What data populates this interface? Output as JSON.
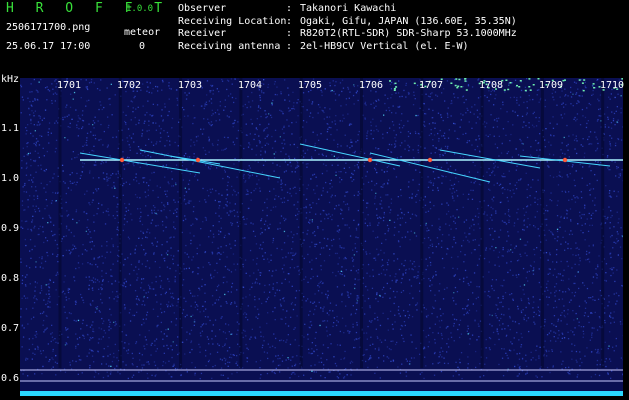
{
  "app": {
    "name": "H R O F F T",
    "version": "1.0.0"
  },
  "file": {
    "name": "2506171700.png",
    "datetime": "25.06.17 17:00",
    "meteor_label": "meteor",
    "meteor_count": "0"
  },
  "info": [
    {
      "label": "Observer",
      "value": "Takanori Kawachi"
    },
    {
      "label": "Receiving Location",
      "value": "Ogaki, Gifu, JAPAN (136.60E, 35.35N)"
    },
    {
      "label": "Receiver",
      "value": "R820T2(RTL-SDR) SDR-Sharp 53.1000MHz"
    },
    {
      "label": "Receiving antenna",
      "value": "2el-HB9CV Vertical (el. E-W)"
    }
  ],
  "plot": {
    "y_unit": "kHz",
    "y_ticks": [
      "1.1",
      "1.0",
      "0.9",
      "0.8",
      "0.7",
      "0.6"
    ],
    "x_ticks": [
      "1701",
      "1702",
      "1703",
      "1704",
      "1705",
      "1706",
      "1707",
      "1708",
      "1709",
      "1710"
    ],
    "colors": {
      "background": "#0a0f52",
      "noise": "#3046c8",
      "signal": "#a9f3ff",
      "meteor": "#ff5a3a",
      "baseline": "#2ad8ff"
    }
  }
}
